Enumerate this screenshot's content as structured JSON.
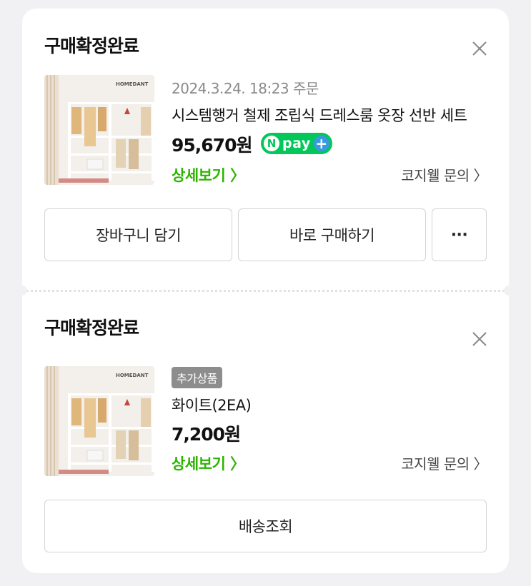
{
  "orders": [
    {
      "status": "구매확정완료",
      "date": "2024.3.24. 18:23 주문",
      "product_name": "시스템행거 철제 조립식 드레스룸 옷장 선반 세트",
      "price": "95,670원",
      "npay": {
        "mark": "N",
        "text": "pay",
        "plus": "+"
      },
      "detail_link": "상세보기 〉",
      "inquiry": "코지웰 문의 〉",
      "buttons": {
        "cart": "장바구니 담기",
        "buy_now": "바로 구매하기",
        "more": "···"
      },
      "thumb_brand": "HOMEDANT"
    },
    {
      "status": "구매확정완료",
      "badge": "추가상품",
      "product_name": "화이트(2EA)",
      "price": "7,200원",
      "detail_link": "상세보기 〉",
      "inquiry": "코지웰 문의 〉",
      "buttons": {
        "track": "배송조회"
      },
      "thumb_brand": "HOMEDANT"
    }
  ],
  "colors": {
    "accent_green": "#2db400",
    "npay_green": "#03c75a"
  }
}
